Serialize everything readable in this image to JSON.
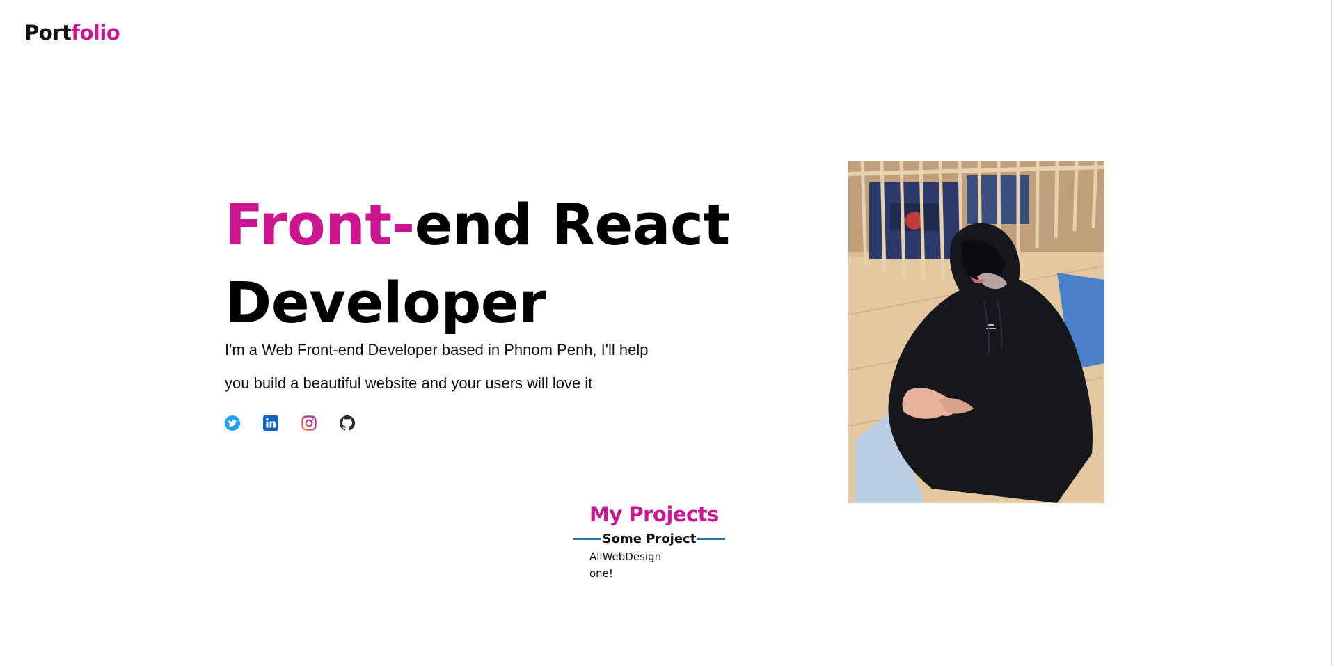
{
  "nav": {
    "logo_part1": "Port",
    "logo_part2": "folio"
  },
  "hero": {
    "title_accent": "Front-",
    "title_rest_line1": "end React",
    "title_line2": "Developer",
    "description": "I'm a Web Front-end Developer based in Phnom Penh, I'll help you build a beautiful website and your users will love it"
  },
  "socials": [
    {
      "icon": "twitter-icon",
      "color": "#1da1f2"
    },
    {
      "icon": "linkedin-icon",
      "color": "#0a66c2"
    },
    {
      "icon": "instagram-icon",
      "color": "#e1306c"
    },
    {
      "icon": "github-icon",
      "color": "#24292e"
    }
  ],
  "projects": {
    "title": "My Projects",
    "subtitle": "Some Project",
    "line1": "AllWebDesign",
    "line2": "one!"
  },
  "colors": {
    "accent": "#cc1590",
    "rule": "#1f6fae"
  }
}
